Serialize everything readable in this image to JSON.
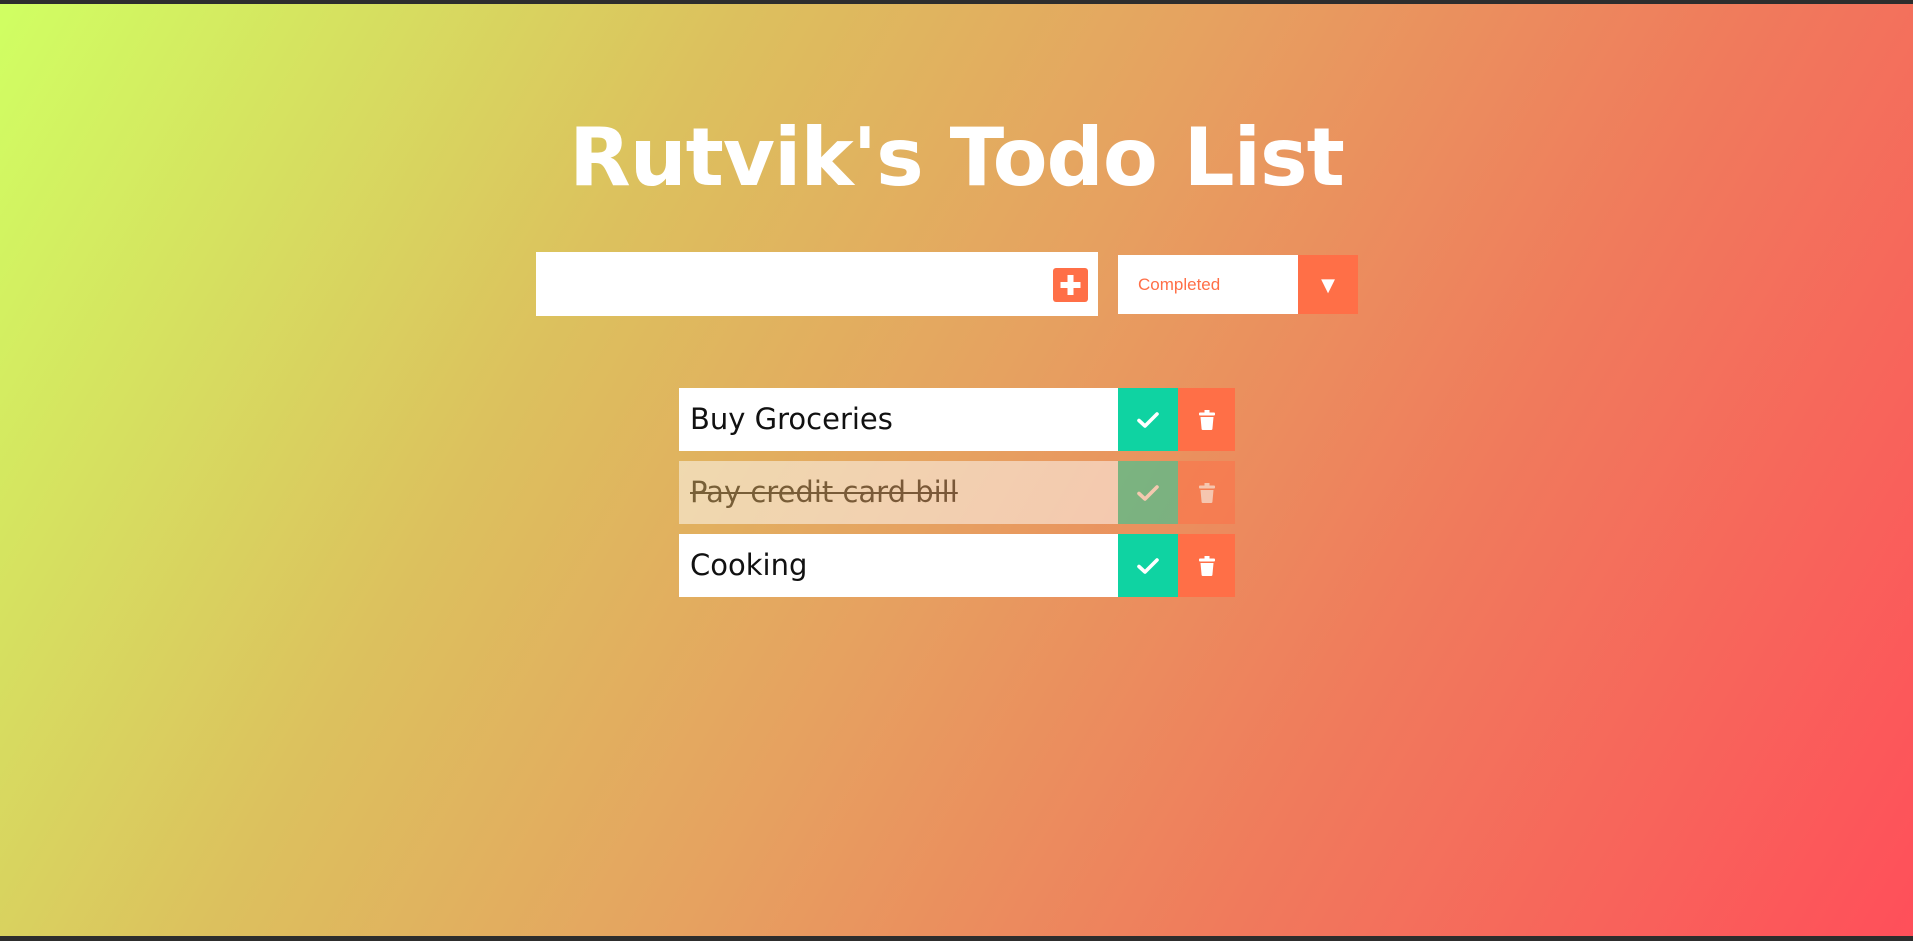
{
  "header": {
    "title": "Rutvik's Todo List"
  },
  "form": {
    "input_value": "",
    "input_placeholder": "",
    "add_icon": "plus-square-icon",
    "filter_selected": "Completed",
    "filter_arrow_icon": "triangle-down-icon"
  },
  "todos": [
    {
      "text": "Buy Groceries",
      "completed": false
    },
    {
      "text": "Pay credit card bill",
      "completed": true
    },
    {
      "text": "Cooking",
      "completed": false
    }
  ],
  "colors": {
    "accent": "#ff6f47",
    "check": "#0fd3a2",
    "gradient_start": "#d0ff62",
    "gradient_end": "#ff4f5a"
  },
  "icons": {
    "complete": "check-icon",
    "delete": "trash-icon"
  }
}
